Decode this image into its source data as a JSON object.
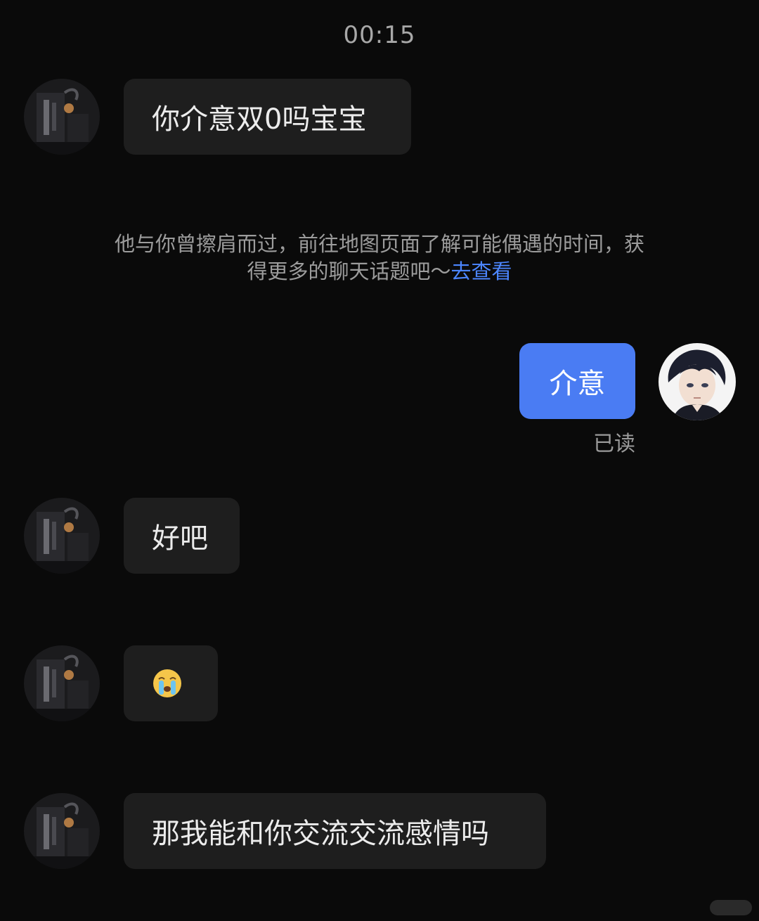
{
  "timestamp": "00:15",
  "messages": [
    {
      "text": "你介意双0吗宝宝"
    },
    {
      "text": "介意"
    },
    {
      "text": "好吧"
    },
    {
      "emoji": "crying-face"
    },
    {
      "text": "那我能和你交流交流感情吗"
    }
  ],
  "system_note": {
    "text": "他与你曾擦肩而过，前往地图页面了解可能偶遇的时间，获得更多的聊天话题吧～",
    "link": "去查看"
  },
  "read_status": "已读",
  "colors": {
    "background": "#0a0a0a",
    "incoming_bubble": "#1e1e1e",
    "outgoing_bubble": "#4a7cf3",
    "link": "#4c86ff"
  }
}
